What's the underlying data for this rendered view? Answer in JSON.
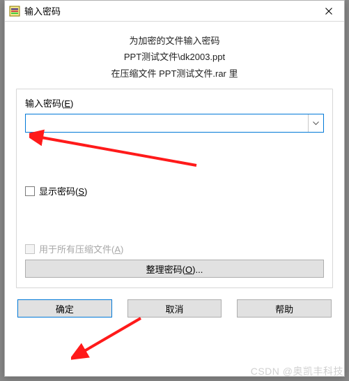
{
  "window": {
    "title": "输入密码"
  },
  "info": {
    "line1": "为加密的文件输入密码",
    "line2": "PPT测试文件\\dk2003.ppt",
    "line3": "在压缩文件 PPT测试文件.rar 里"
  },
  "password": {
    "label_prefix": "输入密码(",
    "label_hotkey": "E",
    "label_suffix": ")",
    "value": ""
  },
  "show_password": {
    "label_prefix": "显示密码(",
    "label_hotkey": "S",
    "label_suffix": ")",
    "checked": false
  },
  "apply_all": {
    "label_prefix": "用于所有压缩文件(",
    "label_hotkey": "A",
    "label_suffix": ")",
    "checked": false,
    "disabled": true
  },
  "organize": {
    "label_prefix": "整理密码(",
    "label_hotkey": "O",
    "label_suffix": ")..."
  },
  "buttons": {
    "ok": "确定",
    "cancel": "取消",
    "help": "帮助"
  },
  "watermark": "CSDN @奥凯丰科技",
  "colors": {
    "accent": "#0078d7"
  }
}
